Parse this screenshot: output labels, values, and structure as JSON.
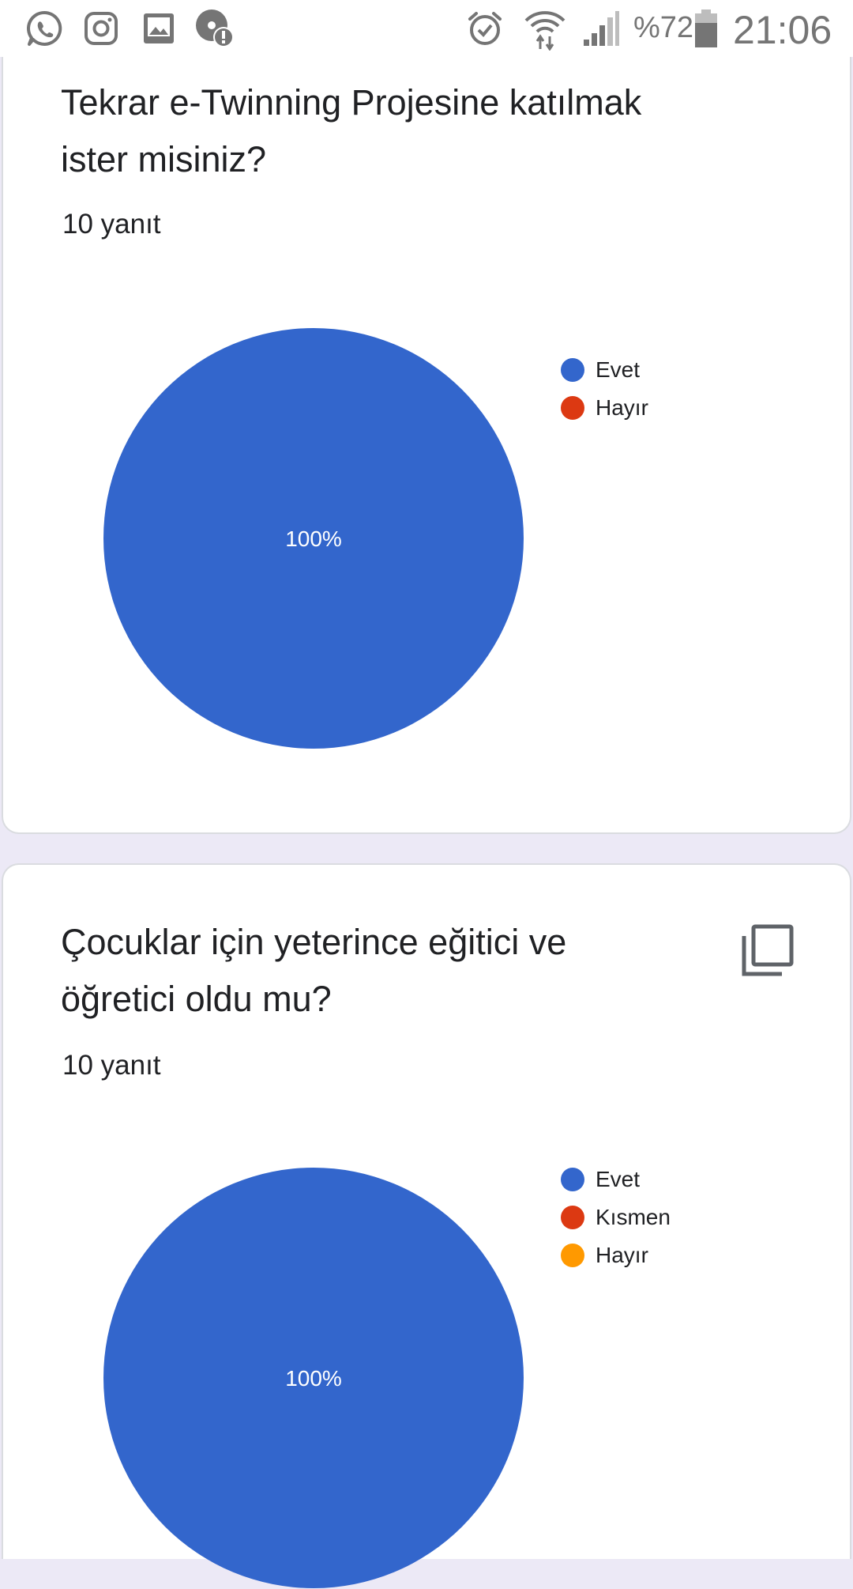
{
  "status_bar": {
    "notification_icons": [
      "whatsapp-icon",
      "instagram-icon",
      "gallery-icon",
      "sync-alert-icon"
    ],
    "system_icons": [
      "alarm-icon",
      "wifi-icon",
      "signal-icon",
      "battery-icon"
    ],
    "battery_percent": "%72",
    "time": "21:06"
  },
  "cards": [
    {
      "question": "Tekrar e-Twinning Projesine katılmak ister misiniz?",
      "response_count": "10 yanıt",
      "chart_data": {
        "type": "pie",
        "labels": [
          "Evet",
          "Hayır"
        ],
        "values": [
          100,
          0
        ],
        "colors": [
          "#3366cc",
          "#dc3912"
        ],
        "slice_labels": [
          "100%",
          ""
        ],
        "legend_position": "right"
      }
    },
    {
      "question": "Çocuklar için yeterince eğitici ve öğretici oldu mu?",
      "response_count": "10 yanıt",
      "copy_icon": "copy-icon",
      "chart_data": {
        "type": "pie",
        "labels": [
          "Evet",
          "Kısmen",
          "Hayır"
        ],
        "values": [
          100,
          0,
          0
        ],
        "colors": [
          "#3366cc",
          "#dc3912",
          "#ff9900"
        ],
        "slice_labels": [
          "100%",
          "",
          ""
        ],
        "legend_position": "right"
      }
    }
  ]
}
